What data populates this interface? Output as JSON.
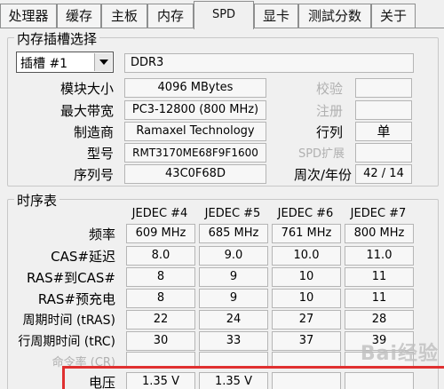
{
  "tabs": [
    "处理器",
    "缓存",
    "主板",
    "内存",
    "SPD",
    "显卡",
    "测試分数",
    "关于"
  ],
  "slot_group": {
    "title": "内存插槽选择",
    "slot_select": "插槽 #1",
    "type_value": "DDR3",
    "labels": {
      "module_size": "模块大小",
      "max_bandwidth": "最大带宽",
      "manufacturer": "制造商",
      "part_number": "型号",
      "serial_number": "序列号",
      "correction": "校验",
      "registered": "注册",
      "ranks": "行列",
      "spd_ext": "SPD扩展",
      "week_year": "周次/年份"
    },
    "values": {
      "module_size": "4096 MBytes",
      "max_bandwidth": "PC3-12800 (800 MHz)",
      "manufacturer": "Ramaxel Technology",
      "part_number": "RMT3170ME68F9F1600",
      "serial_number": "43C0F68D",
      "ranks": "单",
      "week_year": "42 / 14"
    }
  },
  "timing_group": {
    "title": "时序表",
    "columns": [
      "JEDEC #4",
      "JEDEC #5",
      "JEDEC #6",
      "JEDEC #7"
    ],
    "rows": [
      {
        "label": "频率",
        "values": [
          "609 MHz",
          "685 MHz",
          "761 MHz",
          "800 MHz"
        ]
      },
      {
        "label": "CAS#延迟",
        "values": [
          "8.0",
          "9.0",
          "10.0",
          "11.0"
        ]
      },
      {
        "label": "RAS#到CAS#",
        "values": [
          "8",
          "9",
          "10",
          "11"
        ]
      },
      {
        "label": "RAS#预充电",
        "values": [
          "8",
          "9",
          "10",
          "11"
        ]
      },
      {
        "label": "周期时间 (tRAS)",
        "values": [
          "22",
          "24",
          "27",
          "28"
        ]
      },
      {
        "label": "行周期时间 (tRC)",
        "values": [
          "30",
          "33",
          "37",
          "39"
        ]
      },
      {
        "label": "命令率 (CR)",
        "values": [
          "",
          "",
          "",
          ""
        ]
      },
      {
        "label": "电压",
        "values": [
          "1.35 V",
          "1.35 V",
          "",
          ""
        ]
      }
    ]
  },
  "watermark": "Bai经验"
}
